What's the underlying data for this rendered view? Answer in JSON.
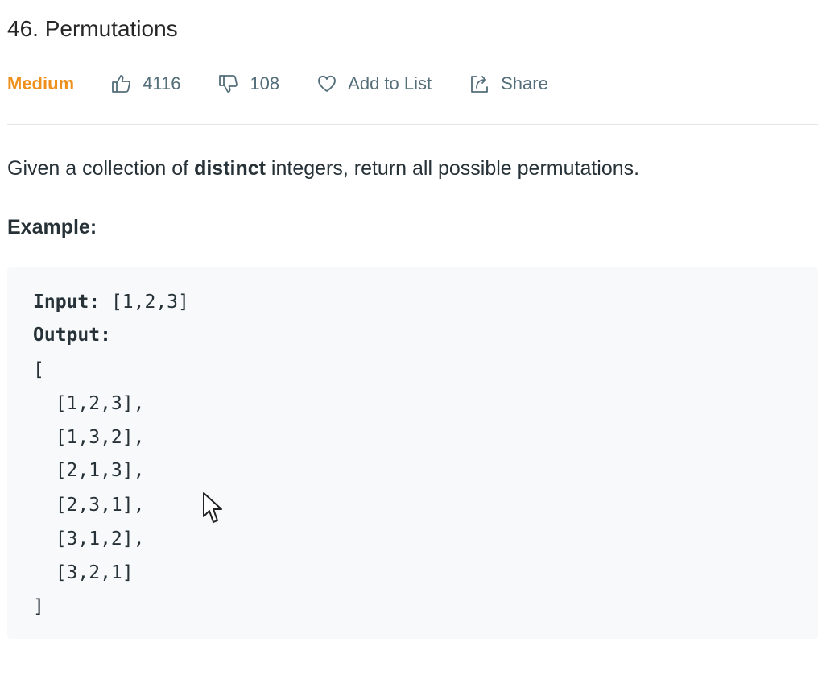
{
  "problem": {
    "title": "46. Permutations",
    "difficulty": "Medium",
    "likes": "4116",
    "dislikes": "108",
    "add_to_list_label": "Add to List",
    "share_label": "Share"
  },
  "description": {
    "prefix": "Given a collection of ",
    "bold": "distinct",
    "suffix": " integers, return all possible permutations."
  },
  "example": {
    "heading": "Example:",
    "input_label": "Input:",
    "input_value": " [1,2,3]",
    "output_label": "Output:",
    "open_bracket": "[",
    "rows": [
      "  [1,2,3],",
      "  [1,3,2],",
      "  [2,1,3],",
      "  [2,3,1],",
      "  [3,1,2],",
      "  [3,2,1]"
    ],
    "close_bracket": "]"
  },
  "colors": {
    "difficulty_medium": "#ef8f1c",
    "meta_text": "#546e7a",
    "code_background": "#f7f9fa"
  },
  "icons": {
    "like": "thumbs-up-icon",
    "dislike": "thumbs-down-icon",
    "favorite": "heart-icon",
    "share": "share-icon",
    "pointer": "mouse-cursor-icon"
  }
}
